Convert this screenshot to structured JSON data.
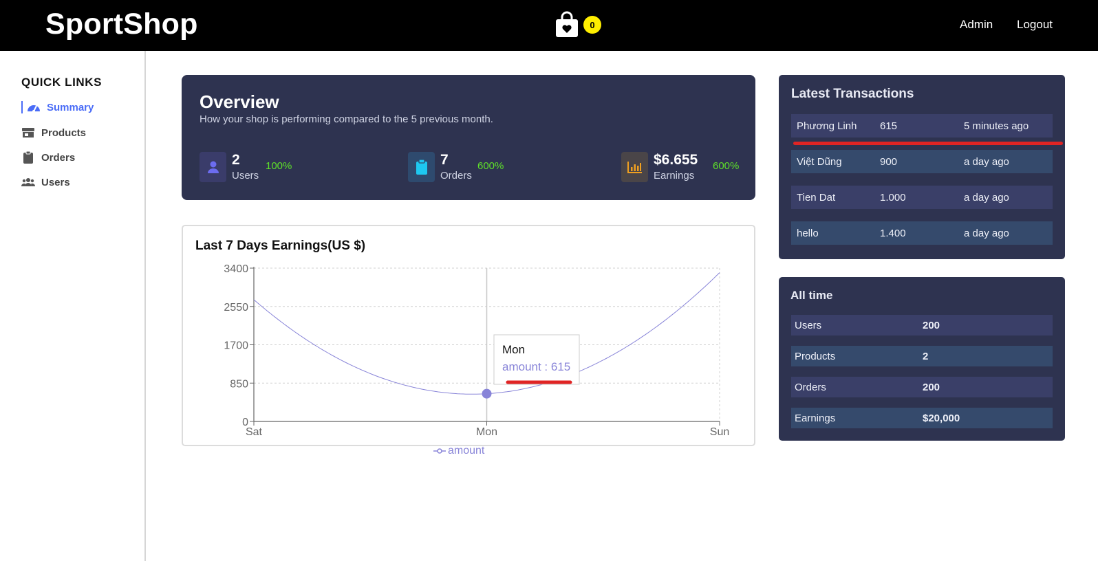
{
  "header": {
    "brand": "SportShop",
    "cart_count": "0",
    "nav": {
      "admin": "Admin",
      "logout": "Logout"
    }
  },
  "sidebar": {
    "title": "QUICK LINKS",
    "items": [
      {
        "label": "Summary",
        "icon": "gauge-icon",
        "active": true
      },
      {
        "label": "Products",
        "icon": "store-icon",
        "active": false
      },
      {
        "label": "Orders",
        "icon": "clipboard-icon",
        "active": false
      },
      {
        "label": "Users",
        "icon": "users-icon",
        "active": false
      }
    ]
  },
  "overview": {
    "title": "Overview",
    "subtitle": "How your shop is performing compared to the 5 previous month.",
    "stats": [
      {
        "value": "2",
        "label": "Users",
        "change": "100%",
        "icon": "user-icon",
        "color": "#6c6cf0"
      },
      {
        "value": "7",
        "label": "Orders",
        "change": "600%",
        "icon": "clipboard-icon",
        "color": "#1ec8f0"
      },
      {
        "value": "$6.655",
        "label": "Earnings",
        "change": "600%",
        "icon": "bar-chart-icon",
        "color": "#f0a020"
      }
    ]
  },
  "chart": {
    "title": "Last 7 Days Earnings(US $)",
    "legend": "amount",
    "tooltip": {
      "title": "Mon",
      "text": "amount : 615"
    }
  },
  "chart_data": {
    "type": "line",
    "categories": [
      "Sat",
      "Mon",
      "Sun"
    ],
    "series": [
      {
        "name": "amount",
        "values": [
          2700,
          615,
          3300
        ]
      }
    ],
    "ylim": [
      0,
      3400
    ],
    "yticks": [
      0,
      850,
      1700,
      2550,
      3400
    ],
    "grid": true,
    "legend_position": "bottom",
    "color": "#8884d8"
  },
  "transactions": {
    "title": "Latest Transactions",
    "rows": [
      {
        "name": "Phương Linh",
        "amount": "615",
        "time": "5 minutes ago"
      },
      {
        "name": "Việt Dũng",
        "amount": "900",
        "time": "a day ago"
      },
      {
        "name": "Tien Dat",
        "amount": "1.000",
        "time": "a day ago"
      },
      {
        "name": "hello",
        "amount": "1.400",
        "time": "a day ago"
      }
    ]
  },
  "all_time": {
    "title": "All time",
    "rows": [
      {
        "label": "Users",
        "value": "200"
      },
      {
        "label": "Products",
        "value": "2"
      },
      {
        "label": "Orders",
        "value": "200"
      },
      {
        "label": "Earnings",
        "value": "$20,000"
      }
    ]
  }
}
